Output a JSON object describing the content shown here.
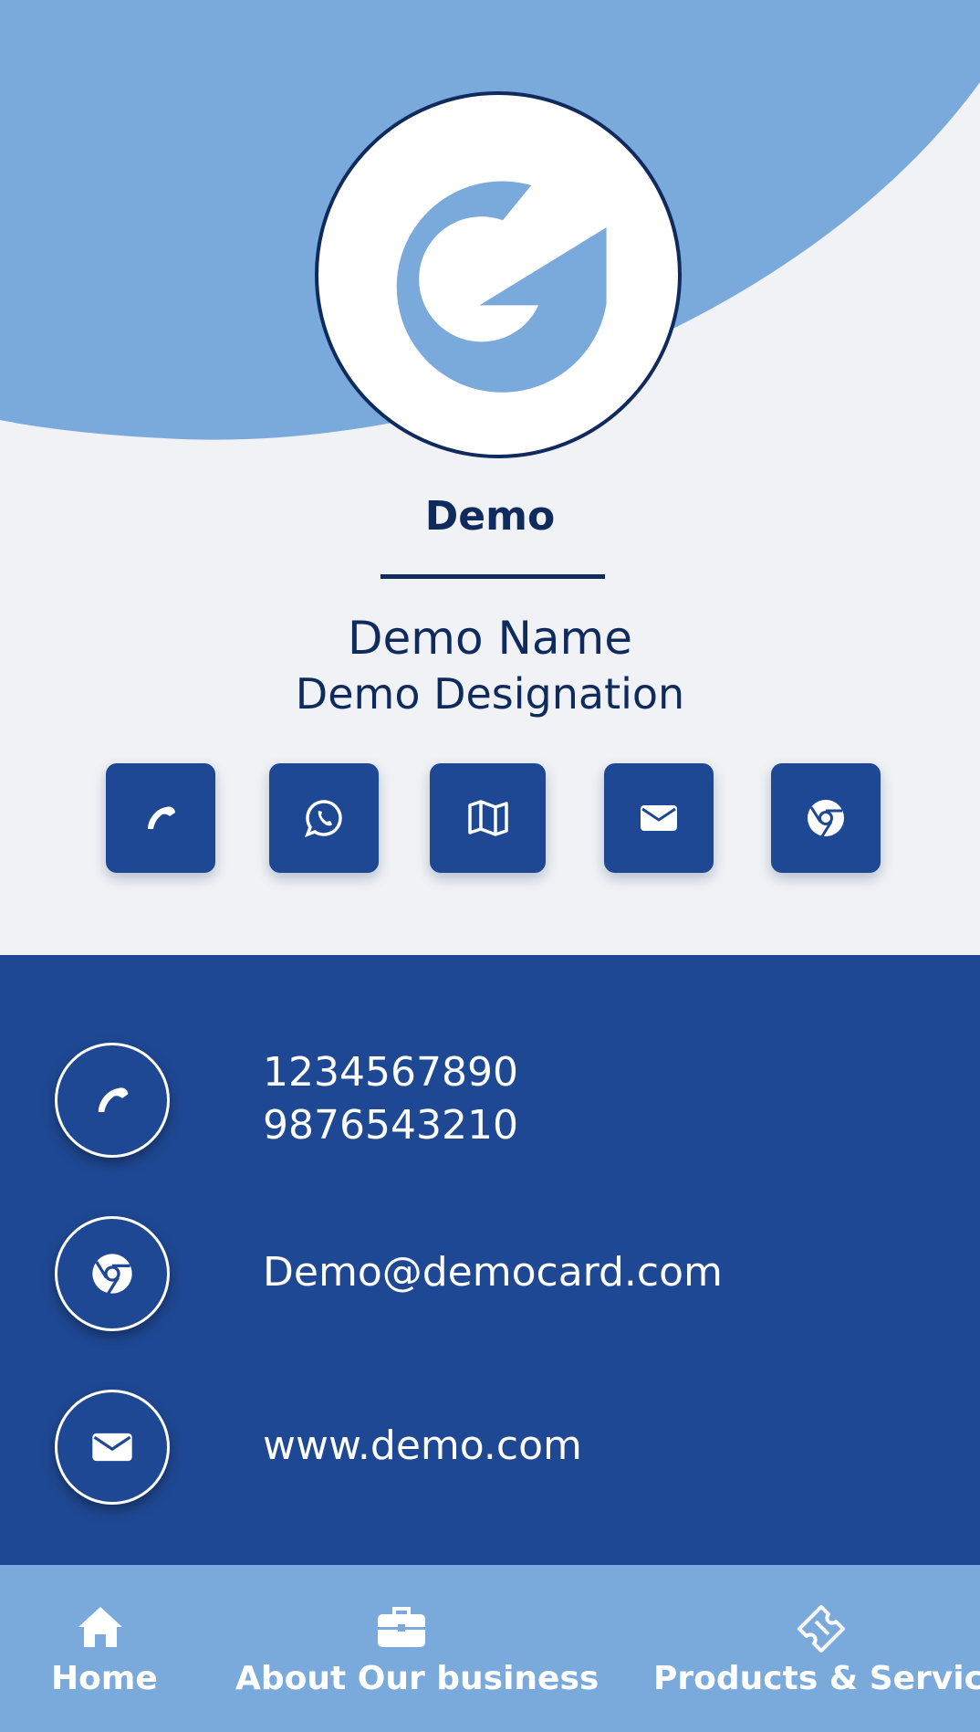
{
  "brand": {
    "company_name": "Demo",
    "colors": {
      "primary_dark": "#0f2a5c",
      "primary": "#1f4894",
      "accent_light": "#7aa9dc",
      "background": "#f0f2f5"
    }
  },
  "profile": {
    "name": "Demo Name",
    "designation": "Demo Designation",
    "logo_icon": "g-logo-icon"
  },
  "quick_actions": [
    {
      "icon": "phone-icon"
    },
    {
      "icon": "whatsapp-icon"
    },
    {
      "icon": "map-icon"
    },
    {
      "icon": "mail-icon"
    },
    {
      "icon": "chrome-icon"
    }
  ],
  "contact": {
    "phones": [
      "1234567890",
      "9876543210"
    ],
    "email": "Demo@democard.com",
    "website": "www.demo.com",
    "icons": [
      "phone-icon",
      "chrome-icon",
      "mail-icon"
    ]
  },
  "bottom_nav": [
    {
      "label": "Home",
      "icon": "home-icon"
    },
    {
      "label": "About Our business",
      "icon": "briefcase-icon"
    },
    {
      "label": "Products & Services",
      "icon": "ticket-icon"
    }
  ]
}
